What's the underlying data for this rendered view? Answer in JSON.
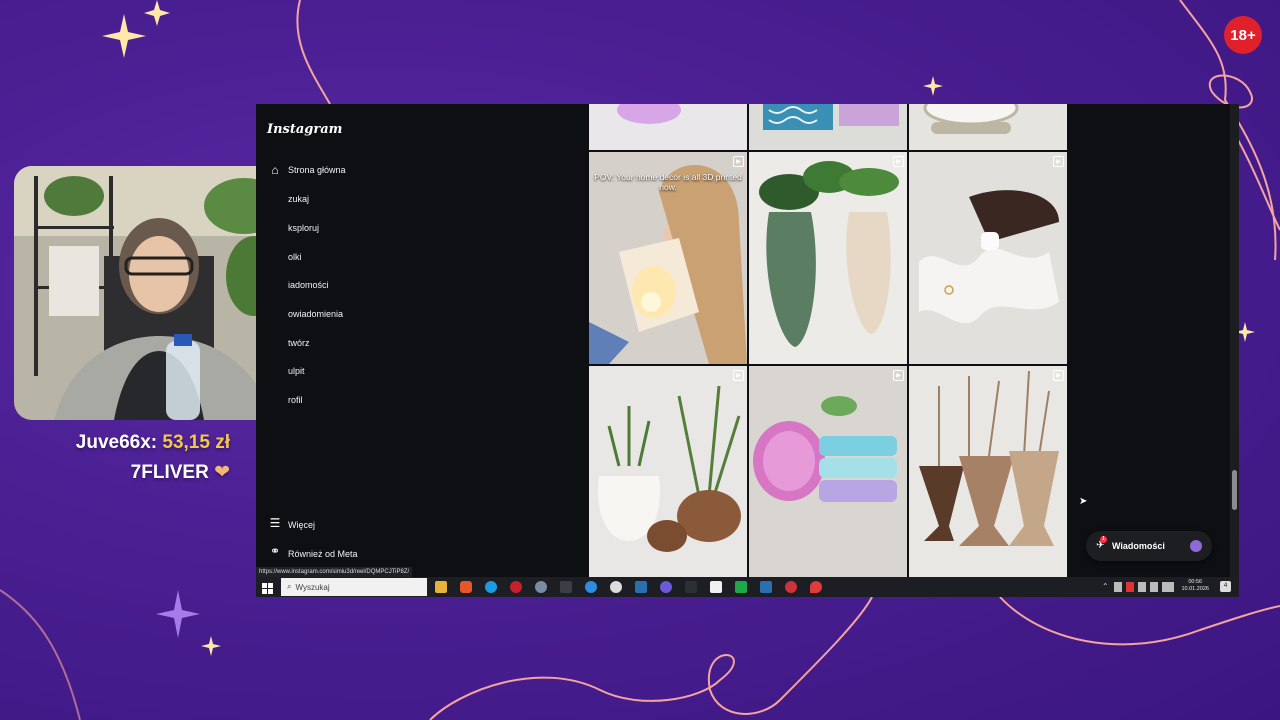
{
  "overlay": {
    "age_badge": "18+",
    "donation_line1_name": "Juve66x:",
    "donation_line1_amount": "53,15 zł",
    "donation_line2_name": "7FLIVER",
    "donation_line2_icon": "heart-icon"
  },
  "instagram": {
    "logo": "Instagram",
    "nav": [
      {
        "label": "Strona główna",
        "icon": "home-icon"
      },
      {
        "label": "zukaj",
        "icon": "search-icon"
      },
      {
        "label": "ksploruj",
        "icon": "compass-icon"
      },
      {
        "label": "olki",
        "icon": "reels-icon"
      },
      {
        "label": "iadomości",
        "icon": "messenger-icon"
      },
      {
        "label": "owiadomienia",
        "icon": "heart-icon"
      },
      {
        "label": "twórz",
        "icon": "plus-icon"
      },
      {
        "label": "ulpit",
        "icon": "chart-icon"
      },
      {
        "label": "rofil",
        "icon": "profile-icon"
      }
    ],
    "more_label": "Więcej",
    "meta_label": "Również od Meta",
    "reel_caption": "POV: Your home decor is all 3D printed now.",
    "status_url": "https://www.instagram.com/simiu3d/reel/DQMPCJTiP8Z/",
    "messages_pill": "Wiadomości",
    "messages_badge": "1"
  },
  "taskbar": {
    "search_placeholder": "Wyszukaj",
    "time": "00:56",
    "date": "10.01.2026",
    "notification_count": "4"
  },
  "colors": {
    "background_purple": "#4a1f92",
    "accent_pink": "#f5a3a0",
    "badge_red": "#e0202b",
    "donation_gold": "#f1c84b"
  }
}
